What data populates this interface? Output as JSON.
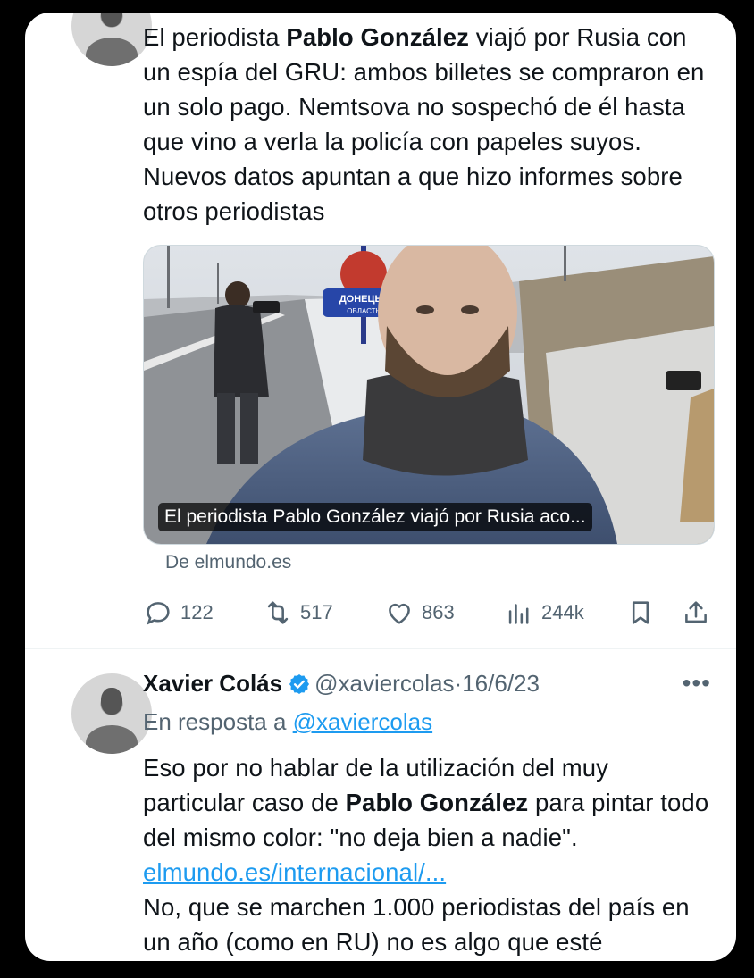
{
  "tweet1": {
    "text_before": "El periodista ",
    "text_bold": "Pablo González",
    "text_after": " viajó por Rusia con un espía del GRU: ambos billetes se compraron en un solo pago. Nemtsova no sospechó de él hasta que vino a verla la policía con papeles suyos. Nuevos datos apuntan a que hizo informes sobre otros periodistas",
    "media_caption": "El periodista Pablo González viajó por Rusia aco...",
    "sign_text_top": "ДОНЕЦЬК",
    "sign_text_bottom": "ОБЛАСТЬ",
    "source": "De elmundo.es",
    "stats": {
      "replies": "122",
      "reposts": "517",
      "likes": "863",
      "views": "244k"
    },
    "icons": [
      "reply-icon",
      "repost-icon",
      "like-icon",
      "views-icon",
      "bookmark-icon",
      "share-icon"
    ]
  },
  "tweet2": {
    "author_name": "Xavier Colás",
    "handle": "@xaviercolas",
    "separator": "·",
    "date": "16/6/23",
    "more": "•••",
    "reply_prefix": "En resposta a ",
    "reply_handle": "@xaviercolas",
    "text_before": "Eso por no hablar de la utilización del muy particular caso de ",
    "text_bold": "Pablo González",
    "text_after": " para pintar todo del mismo color: \"no deja bien a nadie\".",
    "link": "elmundo.es/internacional/...",
    "text_continued": "No, que se marchen 1.000 periodistas del país en un año (como en RU) no es algo que esté"
  },
  "colors": {
    "accent": "#1d9bf0",
    "muted": "#536471",
    "text": "#0f1419",
    "background": "#000000",
    "card": "#ffffff"
  }
}
